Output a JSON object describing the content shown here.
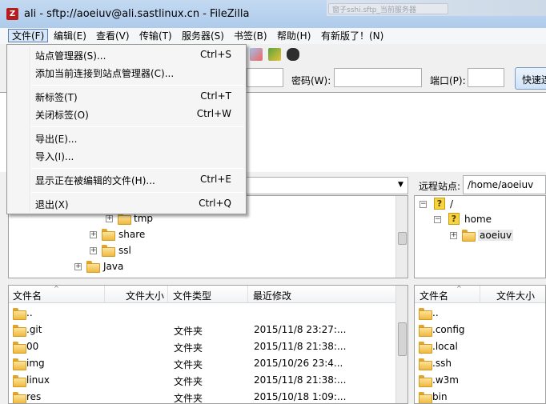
{
  "window": {
    "title": "ali - sftp://aoeiuv@ali.sastlinux.cn - FileZilla",
    "background_tab": "窗子sshi.sftp_当前服务器"
  },
  "menubar": {
    "items": [
      "文件(F)",
      "编辑(E)",
      "查看(V)",
      "传输(T)",
      "服务器(S)",
      "书签(B)",
      "帮助(H)",
      "有新版了！(N)"
    ]
  },
  "file_menu": {
    "items": [
      {
        "label": "站点管理器(S)...",
        "shortcut": "Ctrl+S"
      },
      {
        "label": "添加当前连接到站点管理器(C)...",
        "shortcut": ""
      },
      {
        "label": "新标签(T)",
        "shortcut": "Ctrl+T"
      },
      {
        "label": "关闭标签(O)",
        "shortcut": "Ctrl+W"
      },
      {
        "label": "导出(E)...",
        "shortcut": ""
      },
      {
        "label": "导入(I)...",
        "shortcut": ""
      },
      {
        "label": "显示正在被编辑的文件(H)...",
        "shortcut": "Ctrl+E"
      },
      {
        "label": "退出(X)",
        "shortcut": "Ctrl+Q"
      }
    ]
  },
  "quickconnect": {
    "password_label": "密码(W):",
    "port_label": "端口(P):",
    "button": "快速连接"
  },
  "remote": {
    "path_label": "远程站点:",
    "path": "/home/aoeiuv",
    "tree": [
      "/",
      "home",
      "aoeiuv"
    ]
  },
  "local": {
    "tree": [
      "tmp",
      "share",
      "ssl",
      "Java"
    ]
  },
  "local_list": {
    "columns": [
      "文件名",
      "文件大小",
      "文件类型",
      "最近修改"
    ],
    "rows": [
      {
        "name": "..",
        "size": "",
        "type": "",
        "modified": ""
      },
      {
        "name": ".git",
        "size": "",
        "type": "文件夹",
        "modified": "2015/11/8 23:27:..."
      },
      {
        "name": "00",
        "size": "",
        "type": "文件夹",
        "modified": "2015/11/8 21:38:..."
      },
      {
        "name": "img",
        "size": "",
        "type": "文件夹",
        "modified": "2015/10/26 23:4..."
      },
      {
        "name": "linux",
        "size": "",
        "type": "文件夹",
        "modified": "2015/11/8 21:38:..."
      },
      {
        "name": "res",
        "size": "",
        "type": "文件夹",
        "modified": "2015/10/18 1:09:..."
      }
    ]
  },
  "remote_list": {
    "columns": [
      "文件名",
      "文件大小"
    ],
    "rows": [
      "..",
      ".config",
      ".local",
      ".ssh",
      ".w3m",
      "bin"
    ]
  }
}
